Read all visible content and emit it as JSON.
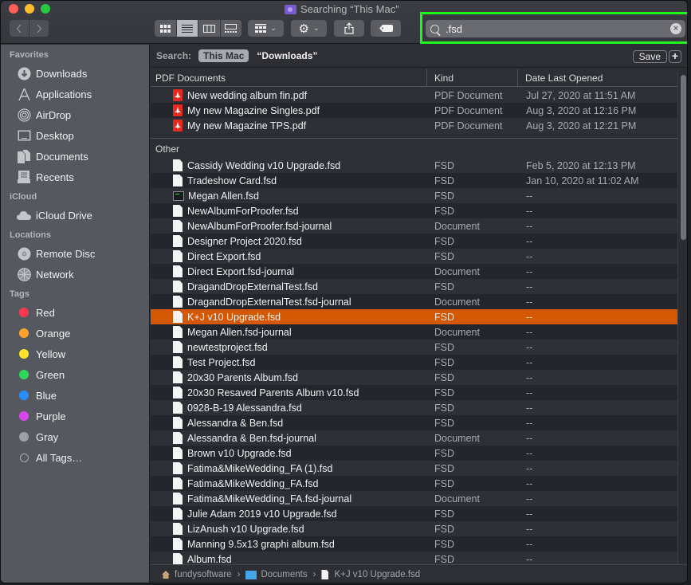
{
  "window": {
    "title": "Searching “This Mac”"
  },
  "toolbar": {
    "back_icon": "chevron-left-icon",
    "forward_icon": "chevron-right-icon",
    "view_modes": [
      "icon-view",
      "list-view",
      "column-view",
      "gallery-view"
    ],
    "active_view": "list-view",
    "group_icon": "group-by-icon",
    "action_icon": "gear-icon",
    "share_icon": "share-icon",
    "tag_icon": "tag-icon"
  },
  "search": {
    "value": ".fsd",
    "clear_icon": "clear-icon"
  },
  "sidebar": {
    "sections": [
      {
        "title": "Favorites",
        "items": [
          {
            "label": "Downloads",
            "icon": "downloads-icon"
          },
          {
            "label": "Applications",
            "icon": "applications-icon"
          },
          {
            "label": "AirDrop",
            "icon": "airdrop-icon"
          },
          {
            "label": "Desktop",
            "icon": "desktop-icon"
          },
          {
            "label": "Documents",
            "icon": "documents-icon"
          },
          {
            "label": "Recents",
            "icon": "recents-icon"
          }
        ]
      },
      {
        "title": "iCloud",
        "items": [
          {
            "label": "iCloud Drive",
            "icon": "cloud-icon"
          }
        ]
      },
      {
        "title": "Locations",
        "items": [
          {
            "label": "Remote Disc",
            "icon": "disc-icon"
          },
          {
            "label": "Network",
            "icon": "network-icon"
          }
        ]
      },
      {
        "title": "Tags",
        "items": [
          {
            "label": "Red",
            "color": "#fb3a4d"
          },
          {
            "label": "Orange",
            "color": "#fda32b"
          },
          {
            "label": "Yellow",
            "color": "#fee42c"
          },
          {
            "label": "Green",
            "color": "#2cd95a"
          },
          {
            "label": "Blue",
            "color": "#2b8cfd"
          },
          {
            "label": "Purple",
            "color": "#d846ee"
          },
          {
            "label": "Gray",
            "color": "#9fa0a4"
          },
          {
            "label": "All Tags…",
            "color": null
          }
        ]
      }
    ]
  },
  "scope_bar": {
    "label": "Search:",
    "selected_scope": "This Mac",
    "other_scope": "“Downloads”",
    "save_label": "Save",
    "add_label": "+"
  },
  "columns": {
    "name": "PDF Documents",
    "kind": "Kind",
    "date": "Date Last Opened"
  },
  "groups": [
    {
      "title": "PDF Documents",
      "files": [
        {
          "name": "New wedding album fin.pdf",
          "kind": "PDF Document",
          "date": "Jul 27, 2020 at 11:51 AM",
          "icon": "pdf"
        },
        {
          "name": "My new Magazine Singles.pdf",
          "kind": "PDF Document",
          "date": "Aug 3, 2020 at 12:16 PM",
          "icon": "pdf"
        },
        {
          "name": "My new Magazine TPS.pdf",
          "kind": "PDF Document",
          "date": "Aug 3, 2020 at 12:21 PM",
          "icon": "pdf"
        }
      ]
    },
    {
      "title": "Other",
      "files": [
        {
          "name": "Cassidy Wedding v10 Upgrade.fsd",
          "kind": "FSD",
          "date": "Feb 5, 2020 at 12:13 PM",
          "icon": "doc"
        },
        {
          "name": "Tradeshow Card.fsd",
          "kind": "FSD",
          "date": "Jan 10, 2020 at 11:02 AM",
          "icon": "doc"
        },
        {
          "name": "Megan Allen.fsd",
          "kind": "FSD",
          "date": "--",
          "icon": "term"
        },
        {
          "name": "NewAlbumForProofer.fsd",
          "kind": "FSD",
          "date": "--",
          "icon": "doc"
        },
        {
          "name": "NewAlbumForProofer.fsd-journal",
          "kind": "Document",
          "date": "--",
          "icon": "doc"
        },
        {
          "name": "Designer Project 2020.fsd",
          "kind": "FSD",
          "date": "--",
          "icon": "doc"
        },
        {
          "name": "Direct Export.fsd",
          "kind": "FSD",
          "date": "--",
          "icon": "doc"
        },
        {
          "name": "Direct Export.fsd-journal",
          "kind": "Document",
          "date": "--",
          "icon": "doc"
        },
        {
          "name": "DragandDropExternalTest.fsd",
          "kind": "FSD",
          "date": "--",
          "icon": "doc"
        },
        {
          "name": "DragandDropExternalTest.fsd-journal",
          "kind": "Document",
          "date": "--",
          "icon": "doc"
        },
        {
          "name": "K+J v10 Upgrade.fsd",
          "kind": "FSD",
          "date": "--",
          "icon": "doc",
          "selected": true
        },
        {
          "name": "Megan Allen.fsd-journal",
          "kind": "Document",
          "date": "--",
          "icon": "doc"
        },
        {
          "name": "newtestproject.fsd",
          "kind": "FSD",
          "date": "--",
          "icon": "doc"
        },
        {
          "name": "Test Project.fsd",
          "kind": "FSD",
          "date": "--",
          "icon": "doc"
        },
        {
          "name": "20x30 Parents Album.fsd",
          "kind": "FSD",
          "date": "--",
          "icon": "doc"
        },
        {
          "name": "20x30 Resaved Parents Album v10.fsd",
          "kind": "FSD",
          "date": "--",
          "icon": "doc"
        },
        {
          "name": "0928-B-19 Alessandra.fsd",
          "kind": "FSD",
          "date": "--",
          "icon": "doc"
        },
        {
          "name": "Alessandra & Ben.fsd",
          "kind": "FSD",
          "date": "--",
          "icon": "doc"
        },
        {
          "name": "Alessandra & Ben.fsd-journal",
          "kind": "Document",
          "date": "--",
          "icon": "doc"
        },
        {
          "name": "Brown v10 Upgrade.fsd",
          "kind": "FSD",
          "date": "--",
          "icon": "doc"
        },
        {
          "name": "Fatima&MikeWedding_FA (1).fsd",
          "kind": "FSD",
          "date": "--",
          "icon": "doc"
        },
        {
          "name": "Fatima&MikeWedding_FA.fsd",
          "kind": "FSD",
          "date": "--",
          "icon": "doc"
        },
        {
          "name": "Fatima&MikeWedding_FA.fsd-journal",
          "kind": "Document",
          "date": "--",
          "icon": "doc"
        },
        {
          "name": "Julie Adam 2019 v10 Upgrade.fsd",
          "kind": "FSD",
          "date": "--",
          "icon": "doc"
        },
        {
          "name": "LizAnush v10 Upgrade.fsd",
          "kind": "FSD",
          "date": "--",
          "icon": "doc"
        },
        {
          "name": "Manning 9.5x13 graphi album.fsd",
          "kind": "FSD",
          "date": "--",
          "icon": "doc"
        },
        {
          "name": "Album.fsd",
          "kind": "FSD",
          "date": "--",
          "icon": "doc"
        }
      ]
    }
  ],
  "path_bar": [
    {
      "label": "fundysoftware",
      "icon": "home-icon"
    },
    {
      "label": "Documents",
      "icon": "documents-folder-icon"
    },
    {
      "label": "K+J v10 Upgrade.fsd",
      "icon": "file-icon"
    }
  ],
  "colors": {
    "selection": "#d45702",
    "search_highlight": "#1ef61e"
  }
}
